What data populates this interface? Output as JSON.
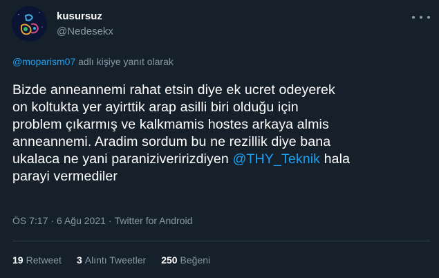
{
  "author": {
    "name": "kusursuz",
    "handle": "@Nedesekx",
    "avatar": "avatar-image"
  },
  "more_icon": "more-horizontal-icon",
  "reply_context": {
    "mention": "@moparism07",
    "suffix": " adlı kişiye yanıt olarak"
  },
  "tweet": {
    "lines": [
      "Bizde anneannemi rahat etsin diye ek ucret odeyerek",
      "on koltukta yer ayirttik arap asilli biri olduğu için",
      "problem çıkarmış ve kalkmamis hostes arkaya almis",
      "anneannemi. Aradim sordum bu ne rezillik diye bana"
    ],
    "line5_before": "ukalaca ne yani paraniziveririzdiyen ",
    "line5_mention": "@THY_Teknik",
    "line5_after": " hala",
    "line6": "parayi vermediler"
  },
  "meta": {
    "time": "ÖS 7:17",
    "date": "6 Ağu 2021",
    "source": "Twitter for Android",
    "separator": "·"
  },
  "stats": {
    "retweets": "19",
    "retweets_label": "Retweet",
    "quotes": "3",
    "quotes_label": "Alıntı Tweetler",
    "likes": "250",
    "likes_label": "Beğeni"
  },
  "colors": {
    "background": "#15202b",
    "link": "#1da1f2",
    "secondary_text": "#8899a6",
    "divider": "#38444d"
  }
}
